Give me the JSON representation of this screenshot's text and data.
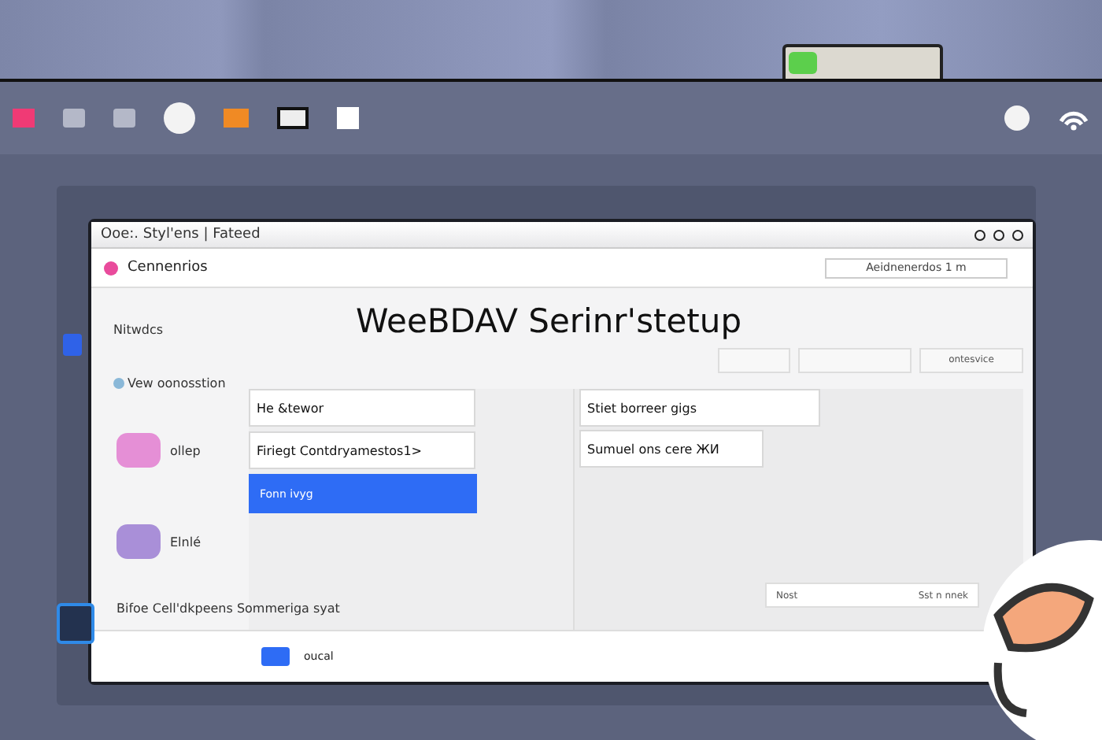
{
  "window": {
    "title": "Ooe:. Styl'ens | Fateed"
  },
  "header": {
    "label": "Cennenrios",
    "search": {
      "value": "Aeidnenerdos 1 m"
    }
  },
  "heading": "WeeBDAV Serinr'stetup",
  "sidebar": {
    "items": [
      {
        "kind": "text",
        "label": "Nitwdcs"
      },
      {
        "kind": "link",
        "label": "Vew oonosstion"
      },
      {
        "kind": "app",
        "label": "ollep",
        "color": "#e58fd6"
      },
      {
        "kind": "app",
        "label": "Elnlé",
        "color": "#a98fd8"
      },
      {
        "kind": "link",
        "label": "Bifoe Cell'dkpeens Sommeriga syat"
      }
    ]
  },
  "toolbar_field": "ontesvice",
  "form": {
    "left_fields": [
      {
        "value": "He &tewor"
      },
      {
        "value": "Firiegt Contdryamestos1>"
      }
    ],
    "button": "Fonn ivyg",
    "right_fields": [
      {
        "value": "Stiet borreer gigs"
      },
      {
        "value": "Sumuel ons cere ЖИ"
      }
    ]
  },
  "footer_row": [
    "Nost",
    "Sst n nnek"
  ],
  "bottom_bar": {
    "label": "oucal"
  }
}
